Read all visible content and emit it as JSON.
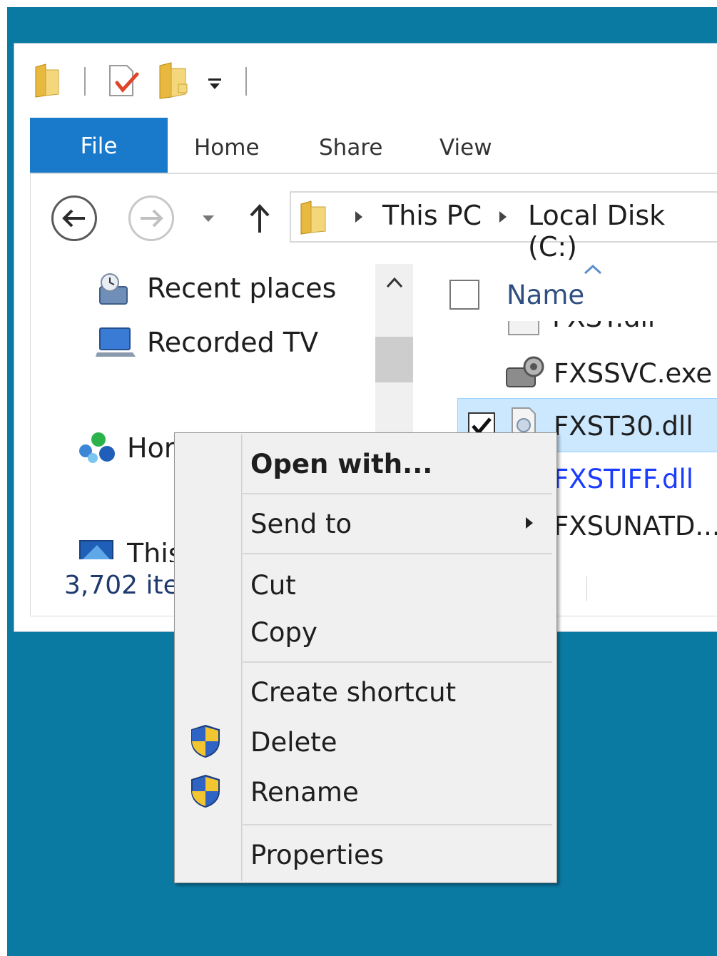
{
  "ribbon": {
    "tabs": [
      {
        "label": "File",
        "active": true
      },
      {
        "label": "Home"
      },
      {
        "label": "Share"
      },
      {
        "label": "View"
      }
    ]
  },
  "address_bar": {
    "segments": [
      "This PC",
      "Local Disk (C:)"
    ]
  },
  "nav_pane": {
    "items": [
      "Recent places",
      "Recorded TV",
      "Hor",
      "This"
    ]
  },
  "file_list": {
    "column_header": "Name",
    "files": [
      {
        "name": "FXSSVC.exe",
        "icon": "fax-service-icon"
      },
      {
        "name": "FXST30.dll",
        "icon": "dll-file-icon",
        "selected": true,
        "checked": true
      },
      {
        "name": "FXSTIFF.dll",
        "icon": "dll-file-icon",
        "color": "#1a3cff"
      },
      {
        "name": "FXSUNATD...",
        "icon": "app-icon"
      }
    ]
  },
  "status_bar": {
    "item_count": "3,702 ite"
  },
  "context_menu": {
    "items": [
      {
        "label": "Open with...",
        "bold": true
      },
      {
        "label": "Send to",
        "submenu": true
      },
      {
        "label": "Cut"
      },
      {
        "label": "Copy"
      },
      {
        "label": "Create shortcut"
      },
      {
        "label": "Delete",
        "icon": "uac-shield-icon"
      },
      {
        "label": "Rename",
        "icon": "uac-shield-icon"
      },
      {
        "label": "Properties"
      }
    ]
  },
  "colors": {
    "desktop": "#0b7aa2",
    "file_tab": "#1979ca",
    "selection": "#cce8ff",
    "link_blue": "#1a3cff"
  }
}
